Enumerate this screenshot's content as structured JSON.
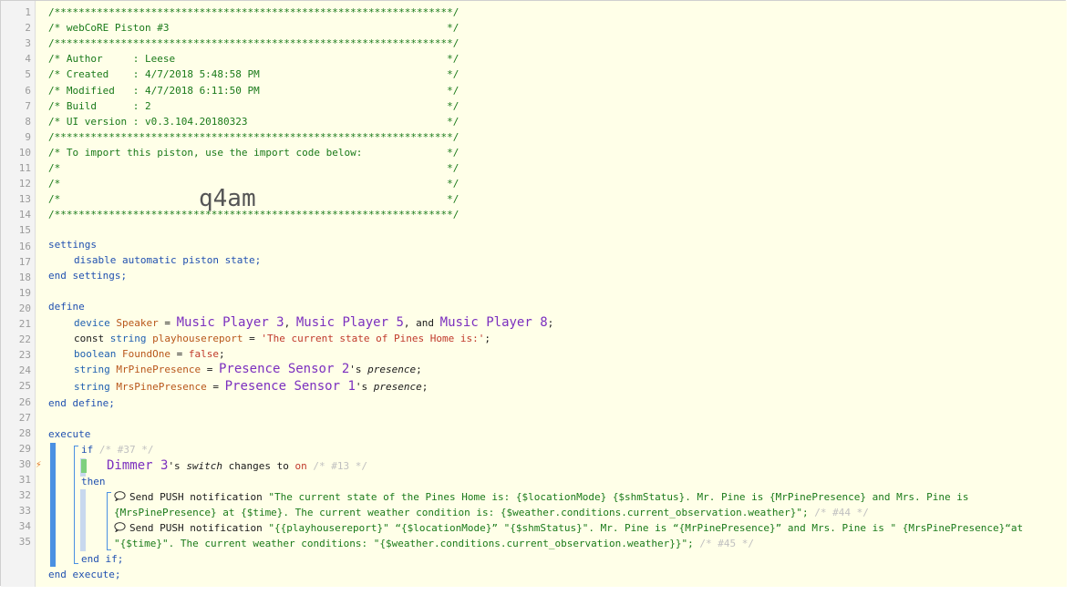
{
  "header_lines": [
    "/******************************************************************/",
    "/* webCoRE Piston #3                                              */",
    "/******************************************************************/",
    "/* Author     : Leese                                             */",
    "/* Created    : 4/7/2018 5:48:58 PM                               */",
    "/* Modified   : 4/7/2018 6:11:50 PM                               */",
    "/* Build      : 2                                                 */",
    "/* UI version : v0.3.104.20180323                                 */",
    "/******************************************************************/",
    "/* To import this piston, use the import code below:              */",
    "/*                                                                */",
    "/*                                                                */",
    "/*                                                                */",
    "/******************************************************************/"
  ],
  "import_code": "q4am",
  "line_numbers": [
    "1",
    "2",
    "3",
    "4",
    "5",
    "6",
    "7",
    "8",
    "9",
    "10",
    "11",
    "12",
    "13",
    "14",
    "15",
    "16",
    "17",
    "18",
    "19",
    "20",
    "21",
    "22",
    "23",
    "24",
    "25",
    "26",
    "27",
    "28",
    "29",
    "30",
    "31",
    "32",
    "33",
    "34",
    "35"
  ],
  "settings": {
    "open": "settings",
    "body": "disable automatic piston state;",
    "close": "end settings;"
  },
  "define": {
    "open": "define",
    "close": "end define;",
    "l21": {
      "type": "device",
      "name": "Speaker",
      "eq": " = ",
      "d1": "Music Player 3",
      "sep1": ", ",
      "d2": "Music Player 5",
      "sep2": ", and ",
      "d3": "Music Player 8",
      "end": ";"
    },
    "l22": {
      "prefix": "const ",
      "type": "string",
      "name": "playhousereport",
      "eq": " = ",
      "value": "'The current state of Pines Home is:'",
      "end": ";"
    },
    "l23": {
      "type": "boolean",
      "name": "FoundOne",
      "eq": " = ",
      "value": "false",
      "end": ";"
    },
    "l24": {
      "type": "string",
      "name": "MrPinePresence",
      "eq": " = ",
      "device": "Presence Sensor 2",
      "poss": "'s ",
      "attr": "presence",
      "end": ";"
    },
    "l25": {
      "type": "string",
      "name": "MrsPinePresence",
      "eq": " = ",
      "device": "Presence Sensor 1",
      "poss": "'s ",
      "attr": "presence",
      "end": ";"
    }
  },
  "execute": {
    "open": "execute",
    "close": "end execute;",
    "if_kw": "if",
    "if_ref": "/* #37 */",
    "cond_device": "Dimmer 3",
    "cond_poss": "'s ",
    "cond_attr": "switch",
    "cond_op": " changes to ",
    "cond_val": "on",
    "cond_ref": "/* #13 */",
    "then_kw": "then",
    "endif_kw": "end if;",
    "action1_label": "Send PUSH notification ",
    "action1_text_a": "\"The current state of the Pines Home is: {$locationMode} {$shmStatus}. Mr. Pine is {MrPinePresence} and Mrs. Pine is",
    "action1_text_b": "{MrsPinePresence} at {$time}. The current weather condition is: {$weather.conditions.current_observation.weather}\";",
    "action1_ref": "/* #44 */",
    "action2_label": "Send PUSH notification ",
    "action2_text_a": "\"{{playhousereport}\" “{$locationMode}” \"{$shmStatus}\". Mr. Pine is “{MrPinePresence}” and Mrs. Pine is \" {MrsPinePresence}“at",
    "action2_text_b": "\"{$time}\". The current weather conditions: \"{$weather.conditions.current_observation.weather}}\";",
    "action2_ref": "/* #45 */"
  },
  "colors": {
    "comment": "#1a7a1a",
    "keyword": "#2050b0",
    "variable": "#b8561a",
    "device": "#7b2fbf",
    "background": "#ffffe8",
    "accent": "#4a90e2"
  },
  "icons": [
    "chat-bubble-icon",
    "lightning-bolt-icon"
  ]
}
